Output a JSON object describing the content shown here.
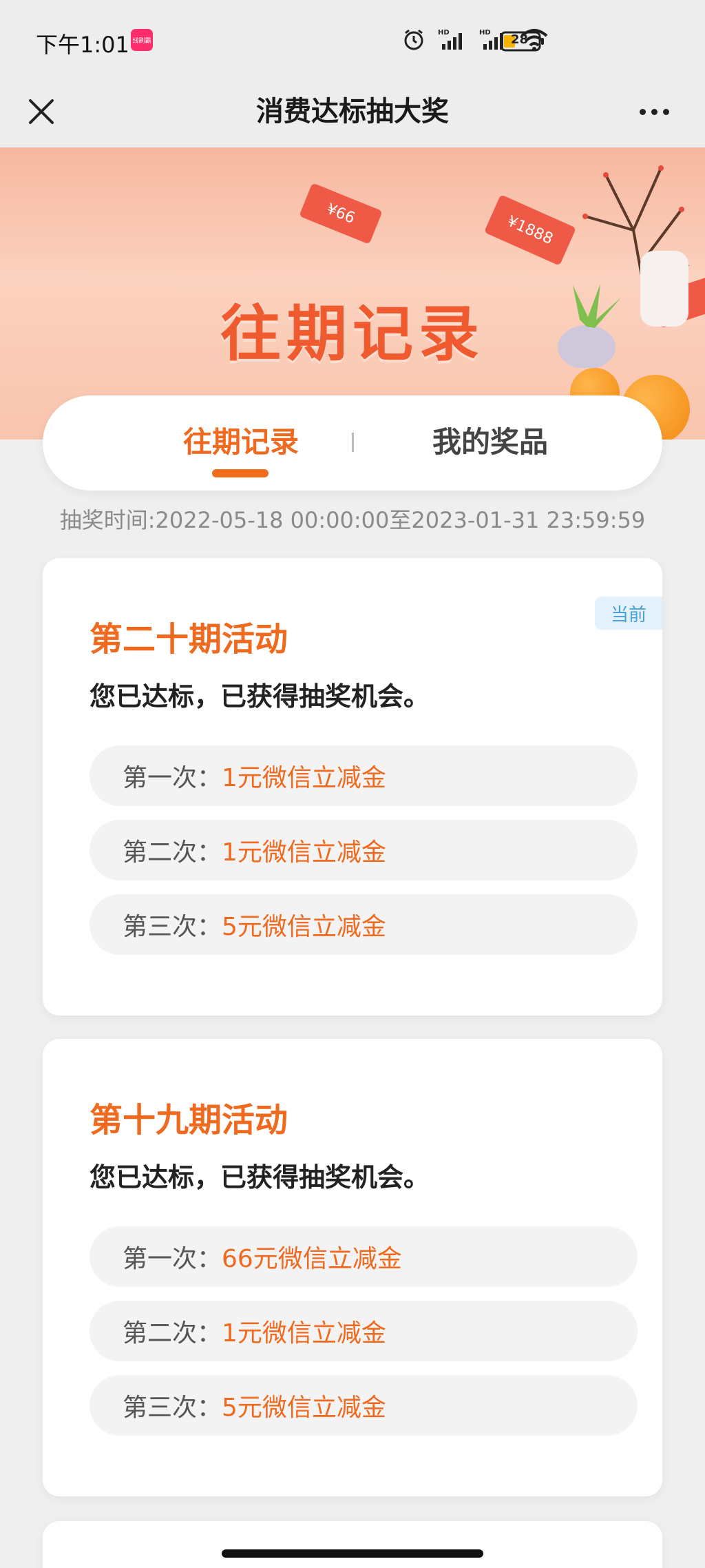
{
  "status_bar": {
    "time": "下午1:01",
    "app_badge": "线刷霸",
    "battery": "28",
    "icons": [
      "alarm-icon",
      "signal-hd-icon",
      "signal-hd-icon",
      "wifi-icon",
      "battery-icon"
    ]
  },
  "nav": {
    "title": "消费达标抽大奖"
  },
  "banner": {
    "title": "往期记录",
    "ticket_1": "¥66",
    "ticket_2": "¥1888"
  },
  "tabs": [
    {
      "label": "往期记录",
      "active": true
    },
    {
      "label": "我的奖品",
      "active": false
    }
  ],
  "lottery_time": "抽奖时间:2022-05-18 00:00:00至2023-01-31 23:59:59",
  "cards": [
    {
      "badge": "当前",
      "title": "第二十期活动",
      "status": "您已达标，已获得抽奖机会。",
      "draws": [
        {
          "label": "第一次：",
          "prize": "1元微信立减金"
        },
        {
          "label": "第二次：",
          "prize": "1元微信立减金"
        },
        {
          "label": "第三次：",
          "prize": "5元微信立减金"
        }
      ]
    },
    {
      "title": "第十九期活动",
      "status": "您已达标，已获得抽奖机会。",
      "draws": [
        {
          "label": "第一次：",
          "prize": "66元微信立减金"
        },
        {
          "label": "第二次：",
          "prize": "1元微信立减金"
        },
        {
          "label": "第三次：",
          "prize": "5元微信立减金"
        }
      ]
    }
  ],
  "colors": {
    "accent": "#ef6a1f",
    "badge_bg": "#e2f1fb",
    "badge_text": "#4a9fd6",
    "page_bg": "#efefef"
  }
}
